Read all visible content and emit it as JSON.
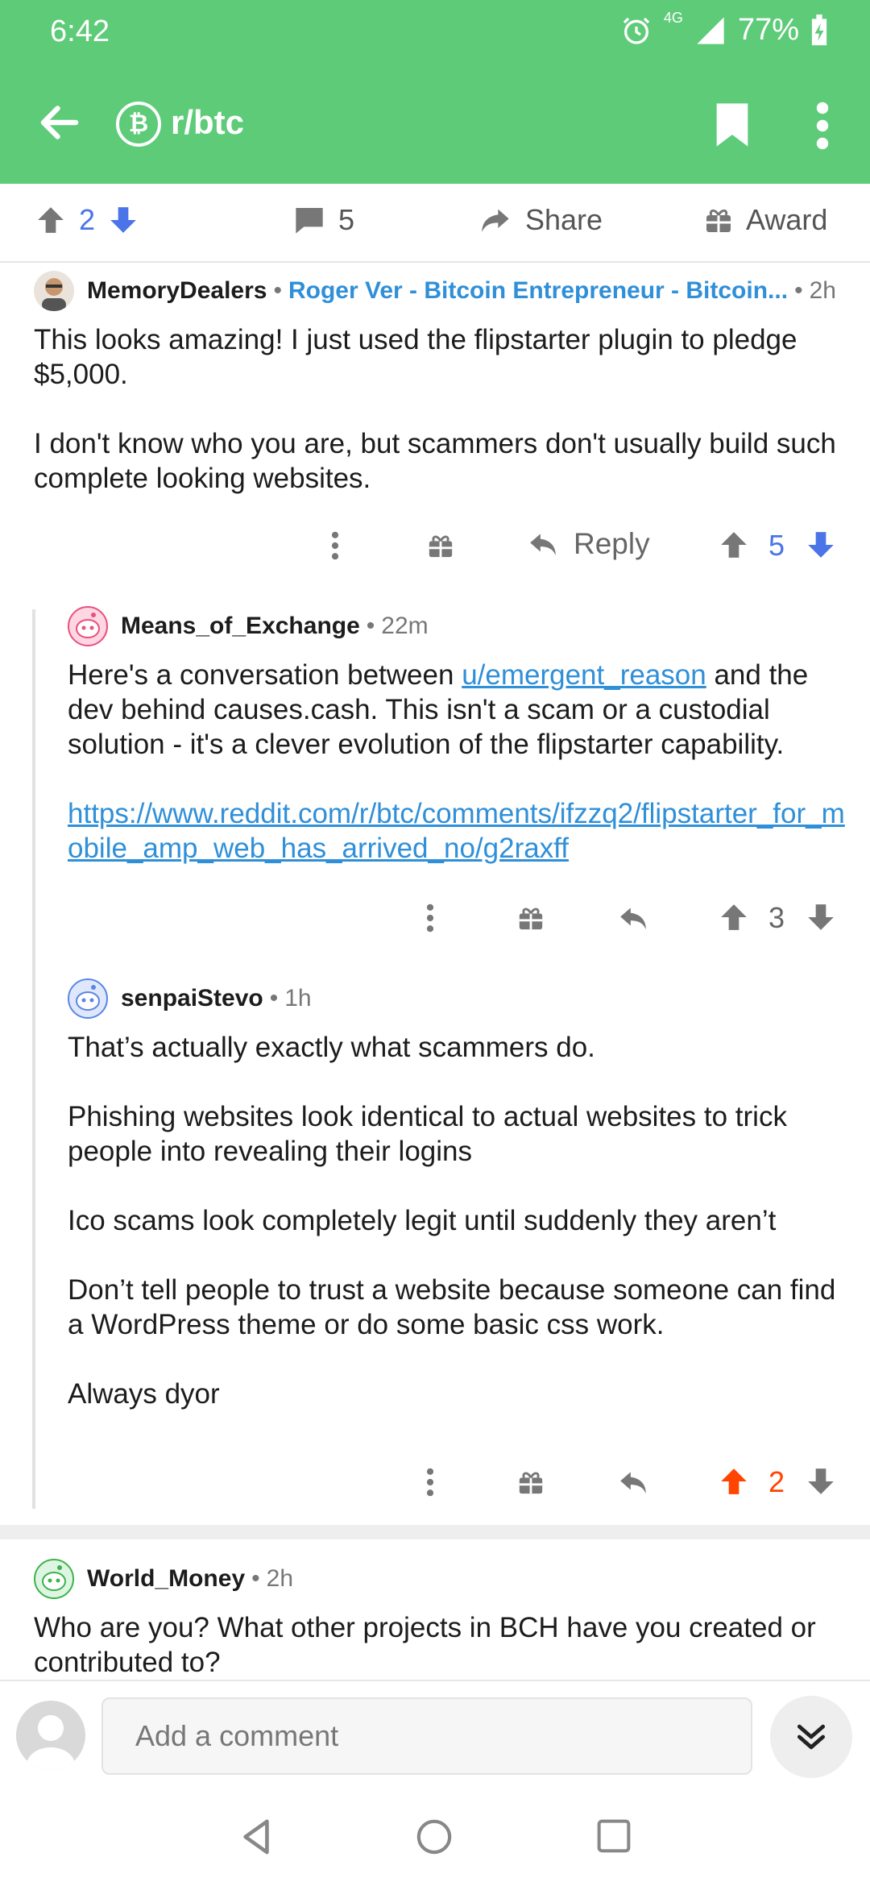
{
  "status_bar": {
    "time": "6:42",
    "network": "4G",
    "battery": "77%"
  },
  "app_bar": {
    "subreddit": "r/btc",
    "subreddit_icon": "bitcoin-cash-icon"
  },
  "post_actions": {
    "score": "2",
    "comments": "5",
    "share": "Share",
    "award": "Award"
  },
  "comments": [
    {
      "author": "MemoryDealers",
      "flair": "Roger Ver - Bitcoin Entrepreneur - Bitcoin...",
      "age": "2h",
      "paragraphs": [
        "This looks amazing!  I just used the flipstarter plugin to pledge $5,000.",
        "I don't know who you are, but scammers don't usually build such complete looking websites."
      ],
      "reply_label": "Reply",
      "score": "5"
    },
    {
      "author": "Means_of_Exchange",
      "age": "22m",
      "text_before_link": "Here's a conversation between ",
      "user_link": "u/emergent_reason",
      "text_after_link": " and the dev behind causes.cash. This isn't a scam or a custodial solution - it's a clever evolution of the flipstarter capability.",
      "url": "https://www.reddit.com/r/btc/comments/ifzzq2/flipstarter_for_mobile_amp_web_has_arrived_no/g2raxff",
      "score": "3"
    },
    {
      "author": "senpaiStevo",
      "age": "1h",
      "paragraphs": [
        "That’s actually exactly what scammers do.",
        "Phishing websites look identical to actual websites to trick people into revealing their logins",
        "Ico scams look completely legit until suddenly they aren’t",
        "Don’t tell people to trust a website because someone can find a WordPress theme or do some basic css work.",
        "Always dyor"
      ],
      "score": "2"
    },
    {
      "author": "World_Money",
      "age": "2h",
      "paragraphs": [
        "Who are you? What other projects in BCH have you created or contributed to?"
      ]
    }
  ],
  "composer": {
    "placeholder": "Add a comment"
  },
  "colors": {
    "header": "#5ecb79",
    "upvote_active": "#ff4500",
    "downvote": "#4a74e8",
    "flair": "#2f8fd8"
  }
}
